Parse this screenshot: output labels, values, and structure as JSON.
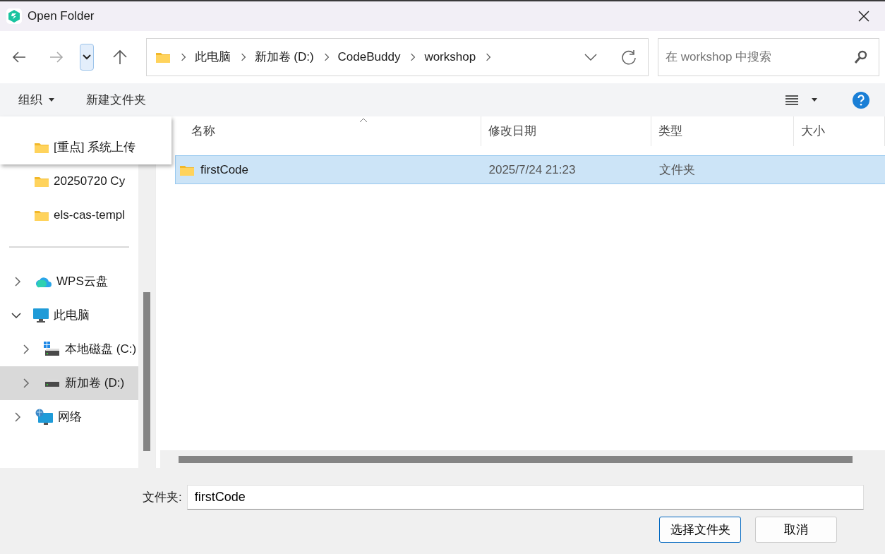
{
  "window": {
    "title": "Open Folder"
  },
  "nav": {
    "history_open": true
  },
  "breadcrumb": [
    "此电脑",
    "新加卷 (D:)",
    "CodeBuddy",
    "workshop"
  ],
  "search": {
    "placeholder": "在 workshop 中搜索"
  },
  "toolbar": {
    "organize": "组织",
    "new_folder": "新建文件夹"
  },
  "sidebar": {
    "items": [
      {
        "kind": "folder",
        "label": "[重点] 系统上传",
        "popup": true
      },
      {
        "kind": "folder",
        "label": "20250720 Cy"
      },
      {
        "kind": "folder",
        "label": "els-cas-templ"
      },
      {
        "kind": "divider"
      },
      {
        "kind": "cloud",
        "label": "WPS云盘",
        "expanded": false,
        "selected": false
      },
      {
        "kind": "computer",
        "label": "此电脑",
        "expanded": true,
        "selected": false,
        "children": [
          {
            "kind": "system-drive",
            "label": "本地磁盘 (C:)",
            "expanded": false,
            "selected": false
          },
          {
            "kind": "drive",
            "label": "新加卷 (D:)",
            "expanded": false,
            "selected": true
          }
        ]
      },
      {
        "kind": "network",
        "label": "网络",
        "expanded": false,
        "selected": false
      }
    ]
  },
  "table": {
    "columns": [
      "名称",
      "修改日期",
      "类型",
      "大小"
    ],
    "rows": [
      {
        "name": "firstCode",
        "modified": "2025/7/24 21:23",
        "type": "文件夹",
        "size": "",
        "selected": true
      }
    ]
  },
  "folder_field": {
    "label": "文件夹:",
    "value": "firstCode"
  },
  "buttons": [
    {
      "label": "选择文件夹",
      "primary": true
    },
    {
      "label": "取消",
      "primary": false
    }
  ]
}
